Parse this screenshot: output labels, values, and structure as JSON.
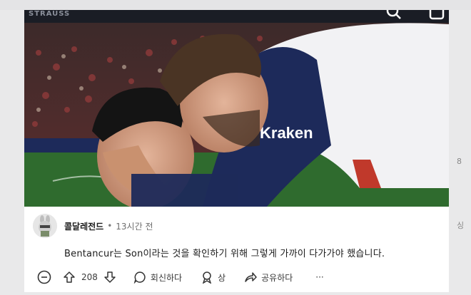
{
  "photo": {
    "brand": "STRAUSS",
    "jersey_sponsor": "Kraken"
  },
  "comment": {
    "author": "콜달레전드",
    "separator": "•",
    "time": "13시간 전",
    "text": "Bentancur는 Son이라는 것을 확인하기 위해 그렇게 가까이 다가가야 했습니다.",
    "score": "208",
    "reply_label": "회신하다",
    "award_label": "상",
    "share_label": "공유하다",
    "more_label": "···"
  },
  "right_edge": {
    "label_1": "8",
    "label_2": "싱"
  },
  "colors": {
    "accent": "#1c1c1c",
    "muted": "#6f6f6f",
    "pitch": "#2f6b2e",
    "navy": "#1d2a5a"
  }
}
